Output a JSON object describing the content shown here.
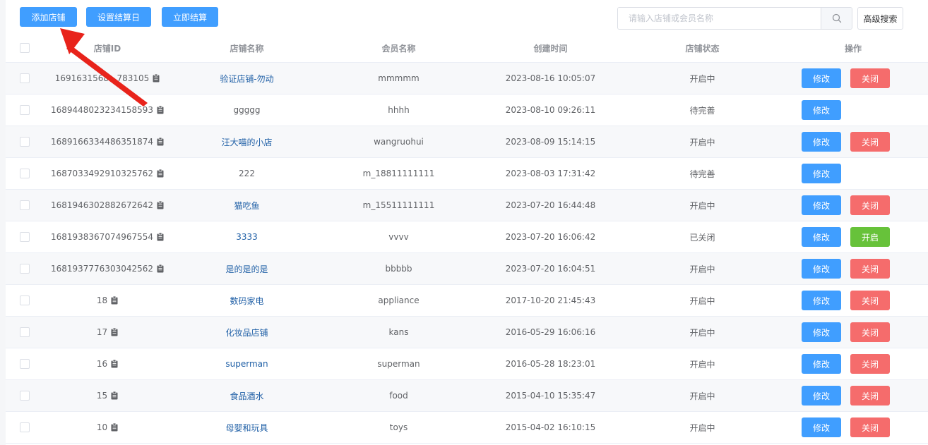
{
  "toolbar": {
    "add_label": "添加店铺",
    "settle_day_label": "设置结算日",
    "settle_now_label": "立即结算",
    "search_placeholder": "请输入店铺或会员名称",
    "advanced_label": "高级搜索"
  },
  "table": {
    "headers": {
      "id": "店铺ID",
      "name": "店铺名称",
      "member": "会员名称",
      "created": "创建时间",
      "status": "店铺状态",
      "ops": "操作"
    },
    "rows": [
      {
        "id": "1691631568...783105",
        "name": "验证店铺-勿动",
        "member": "mmmmm",
        "created": "2023-08-16 10:05:07",
        "status": "开启中",
        "edit": "修改",
        "toggle": "关闭",
        "toggle_type": "close",
        "link": true
      },
      {
        "id": "1689448023234158593",
        "name": "ggggg",
        "member": "hhhh",
        "created": "2023-08-10 09:26:11",
        "status": "待完善",
        "edit": "修改",
        "toggle": "",
        "toggle_type": "",
        "link": false
      },
      {
        "id": "1689166334486351874",
        "name": "汪大喵的小店",
        "member": "wangruohui",
        "created": "2023-08-09 15:14:15",
        "status": "开启中",
        "edit": "修改",
        "toggle": "关闭",
        "toggle_type": "close",
        "link": true
      },
      {
        "id": "1687033492910325762",
        "name": "222",
        "member": "m_18811111111",
        "created": "2023-08-03 17:31:42",
        "status": "待完善",
        "edit": "修改",
        "toggle": "",
        "toggle_type": "",
        "link": false
      },
      {
        "id": "1681946302882672642",
        "name": "猫吃鱼",
        "member": "m_15511111111",
        "created": "2023-07-20 16:44:48",
        "status": "开启中",
        "edit": "修改",
        "toggle": "关闭",
        "toggle_type": "close",
        "link": true
      },
      {
        "id": "1681938367074967554",
        "name": "3333",
        "member": "vvvv",
        "created": "2023-07-20 16:06:42",
        "status": "已关闭",
        "edit": "修改",
        "toggle": "开启",
        "toggle_type": "open",
        "link": true
      },
      {
        "id": "1681937776303042562",
        "name": "是的是的是",
        "member": "bbbbb",
        "created": "2023-07-20 16:04:51",
        "status": "开启中",
        "edit": "修改",
        "toggle": "关闭",
        "toggle_type": "close",
        "link": true
      },
      {
        "id": "18",
        "name": "数码家电",
        "member": "appliance",
        "created": "2017-10-20 21:45:43",
        "status": "开启中",
        "edit": "修改",
        "toggle": "关闭",
        "toggle_type": "close",
        "link": true
      },
      {
        "id": "17",
        "name": "化妆品店铺",
        "member": "kans",
        "created": "2016-05-29 16:06:16",
        "status": "开启中",
        "edit": "修改",
        "toggle": "关闭",
        "toggle_type": "close",
        "link": true
      },
      {
        "id": "16",
        "name": "superman",
        "member": "superman",
        "created": "2016-05-28 18:23:01",
        "status": "开启中",
        "edit": "修改",
        "toggle": "关闭",
        "toggle_type": "close",
        "link": true
      },
      {
        "id": "15",
        "name": "食品酒水",
        "member": "food",
        "created": "2015-04-10 15:35:47",
        "status": "开启中",
        "edit": "修改",
        "toggle": "关闭",
        "toggle_type": "close",
        "link": true
      },
      {
        "id": "10",
        "name": "母婴和玩具",
        "member": "toys",
        "created": "2015-04-02 16:10:15",
        "status": "开启中",
        "edit": "修改",
        "toggle": "关闭",
        "toggle_type": "close",
        "link": true
      }
    ]
  },
  "icons": {
    "copy": "clipboard-icon",
    "search": "search-icon",
    "annotation": "red-arrow-icon"
  },
  "colors": {
    "primary": "#409eff",
    "danger": "#f56c6c",
    "success": "#67c23a",
    "link": "#1f5fa6",
    "arrow": "#e8231b"
  }
}
